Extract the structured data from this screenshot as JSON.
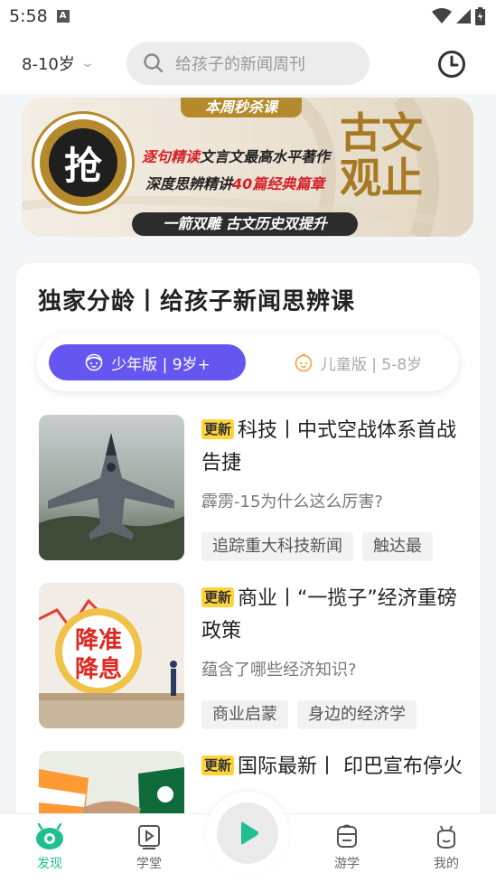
{
  "status_bar": {
    "time": "5:58"
  },
  "top_bar": {
    "age_select": "8-10岁",
    "search_placeholder": "给孩子的新闻周刊"
  },
  "banner": {
    "ribbon": "本周秒杀课",
    "badge": "抢",
    "line1_a": "逐句精读",
    "line1_b": "文言文最高水平著作",
    "line2_a": "深度思辨精讲",
    "line2_b": "40篇经典篇章",
    "big_text": "古文观止",
    "pill": "一箭双雕 古文历史双提升"
  },
  "section": {
    "title": "独家分龄丨给孩子新闻思辨课",
    "segments": [
      {
        "label": "少年版 | 9岁+",
        "active": true
      },
      {
        "label": "儿童版 | 5-8岁",
        "active": false
      }
    ]
  },
  "articles": [
    {
      "badge": "更新",
      "title": "科技丨中式空战体系首战告捷",
      "subtitle": "霹雳-15为什么这么厉害?",
      "tags": [
        "追踪重大科技新闻",
        "触达最"
      ]
    },
    {
      "badge": "更新",
      "title": "商业丨“一揽子”经济重磅政策",
      "subtitle": "蕴含了哪些经济知识?",
      "tags": [
        "商业启蒙",
        "身边的经济学"
      ],
      "thumb_text1": "降准",
      "thumb_text2": "降息"
    },
    {
      "badge": "更新",
      "title": "国际最新丨 印巴宣布停火"
    }
  ],
  "tab_bar": {
    "tabs": [
      {
        "label": "发现",
        "icon": "discover-icon",
        "active": true
      },
      {
        "label": "学堂",
        "icon": "classroom-icon",
        "active": false
      },
      {
        "label": "游学",
        "icon": "study-tour-icon",
        "active": false
      },
      {
        "label": "我的",
        "icon": "profile-icon",
        "active": false
      }
    ]
  },
  "colors": {
    "accent": "#1fbf8f",
    "segment_active": "#6656f0",
    "badge_yellow": "#ffd43b",
    "banner_gold": "#b48a2c"
  }
}
